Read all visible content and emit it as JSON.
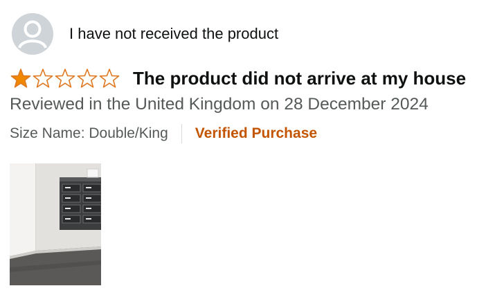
{
  "review": {
    "profile_name": "I have not received the product",
    "rating": 1,
    "max_rating": 5,
    "title": "The product did not arrive at my house",
    "date_text": "Reviewed in the United Kingdom on 28 December 2024",
    "size_name": "Size Name: Double/King",
    "verified_label": "Verified Purchase",
    "image_count": 1
  },
  "colors": {
    "star_filled": "#f08804",
    "star_outline": "#de7921",
    "verified": "#c45500",
    "secondary_text": "#565959",
    "primary_text": "#0f1111"
  },
  "icons": {
    "avatar": "default-user-avatar-icon",
    "star": "star-icon"
  }
}
